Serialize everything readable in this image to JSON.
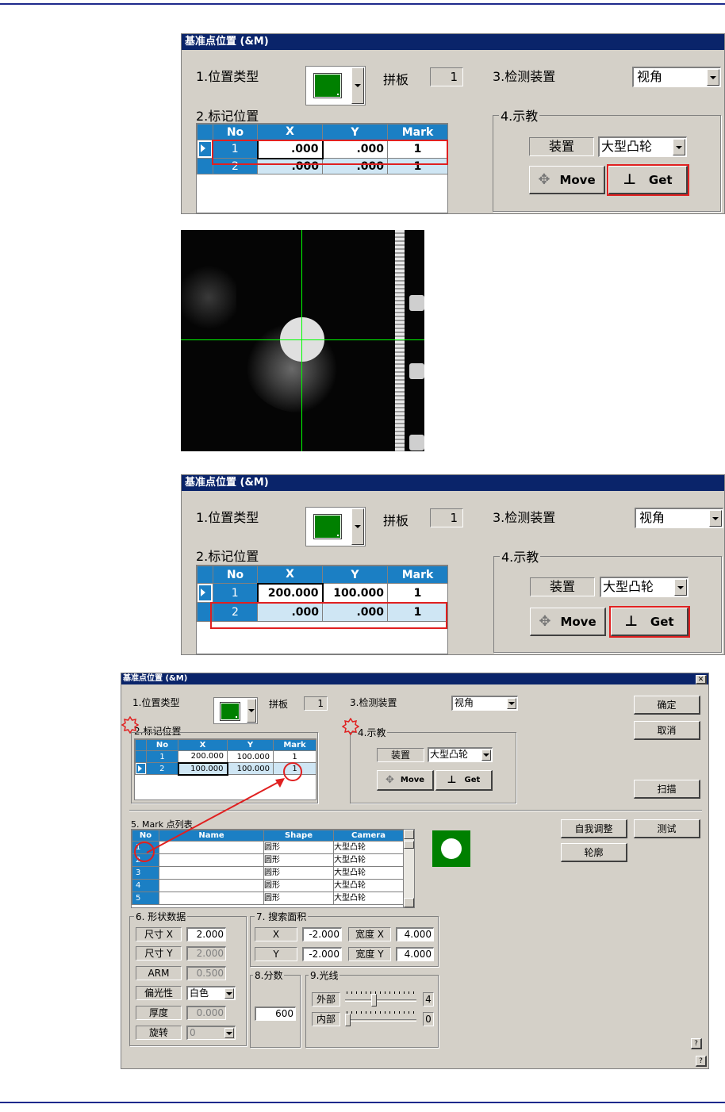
{
  "dialog_top": {
    "title": "基准点位置 (&M)",
    "position_type_label": "1.位置类型",
    "panel_label": "拼板",
    "panel_value": "1",
    "detect_label": "3.检测装置",
    "detect_value": "视角",
    "mark_pos_label": "2.标记位置",
    "teach_label": "4.示教",
    "device_label": "装置",
    "device_value": "大型凸轮",
    "move_label": "Move",
    "get_label": "Get",
    "columns": [
      "No",
      "X",
      "Y",
      "Mark"
    ],
    "rows": [
      {
        "no": "1",
        "x": ".000",
        "y": ".000",
        "mark": "1"
      },
      {
        "no": "2",
        "x": ".000",
        "y": ".000",
        "mark": "1"
      }
    ]
  },
  "dialog_mid": {
    "title": "基准点位置 (&M)",
    "position_type_label": "1.位置类型",
    "panel_label": "拼板",
    "panel_value": "1",
    "detect_label": "3.检测装置",
    "detect_value": "视角",
    "mark_pos_label": "2.标记位置",
    "teach_label": "4.示教",
    "device_label": "装置",
    "device_value": "大型凸轮",
    "move_label": "Move",
    "get_label": "Get",
    "columns": [
      "No",
      "X",
      "Y",
      "Mark"
    ],
    "rows": [
      {
        "no": "1",
        "x": "200.000",
        "y": "100.000",
        "mark": "1"
      },
      {
        "no": "2",
        "x": ".000",
        "y": ".000",
        "mark": "1"
      }
    ]
  },
  "dialog_full": {
    "title": "基准点位置 (&M)",
    "position_type_label": "1.位置类型",
    "panel_label": "拼板",
    "panel_value": "1",
    "detect_label": "3.检测装置",
    "detect_value": "视角",
    "mark_pos_label": "2.标记位置",
    "teach_label": "4.示教",
    "device_label": "装置",
    "device_value": "大型凸轮",
    "move_label": "Move",
    "get_label": "Get",
    "ok_label": "确定",
    "cancel_label": "取消",
    "scan_label": "扫描",
    "columns": [
      "No",
      "X",
      "Y",
      "Mark"
    ],
    "rows": [
      {
        "no": "1",
        "x": "200.000",
        "y": "100.000",
        "mark": "1"
      },
      {
        "no": "2",
        "x": "100.000",
        "y": "100.000",
        "mark": "1"
      }
    ],
    "mark_list_label": "5. Mark 点列表",
    "mark_list_columns": [
      "No",
      "Name",
      "Shape",
      "Camera"
    ],
    "mark_list_rows": [
      {
        "no": "1",
        "name": "",
        "shape": "圆形",
        "camera": "大型凸轮"
      },
      {
        "no": "2",
        "name": "",
        "shape": "圆形",
        "camera": "大型凸轮"
      },
      {
        "no": "3",
        "name": "",
        "shape": "圆形",
        "camera": "大型凸轮"
      },
      {
        "no": "4",
        "name": "",
        "shape": "圆形",
        "camera": "大型凸轮"
      },
      {
        "no": "5",
        "name": "",
        "shape": "圆形",
        "camera": "大型凸轮"
      }
    ],
    "self_adjust_label": "自我调整",
    "test_label": "测试",
    "contour_label": "轮廓",
    "shape_data_label": "6. 形状数据",
    "size_x_label": "尺寸 X",
    "size_x_value": "2.000",
    "size_y_label": "尺寸 Y",
    "size_y_value": "2.000",
    "arm_label": "ARM",
    "arm_value": "0.500",
    "polarity_label": "偏光性",
    "polarity_value": "白色",
    "thickness_label": "厚度",
    "thickness_value": "0.000",
    "rotate_label": "旋转",
    "rotate_value": "0",
    "search_area_label": "7. 搜索面积",
    "search_x_label": "X",
    "search_x_value": "-2.000",
    "search_y_label": "Y",
    "search_y_value": "-2.000",
    "width_x_label": "宽度 X",
    "width_x_value": "4.000",
    "width_y_label": "宽度 Y",
    "width_y_value": "4.000",
    "score_label": "8.分数",
    "score_value": "600",
    "light_label": "9.光线",
    "outer_label": "外部",
    "outer_value": "4",
    "outer_level": 0.4,
    "inner_label": "内部",
    "inner_value": "0",
    "inner_level": 0.0,
    "help_label": "?",
    "close_label": "✕"
  },
  "colors": {
    "title_bar": "#0a246a",
    "grid_header": "#1b7fc4",
    "highlight": "#e02020",
    "mark_green": "#008000",
    "crosshair": "#00ff00"
  }
}
